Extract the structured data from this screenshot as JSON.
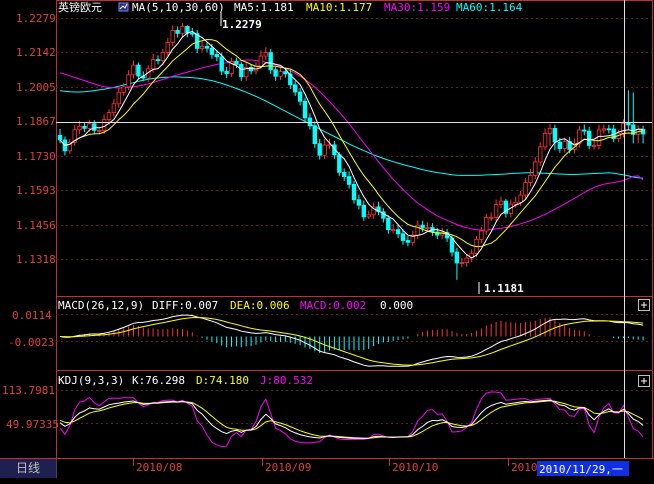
{
  "instrument": "英镑欧元",
  "period_tab": "日线",
  "colors": {
    "up": "#ff3232",
    "down": "#00ffff",
    "ma5": "#ffffff",
    "ma10": "#ffff00",
    "ma30": "#ff00ff",
    "ma60": "#00ffff",
    "axis": "#e04040"
  },
  "main_header": {
    "ma_label": "MA(5,10,30,60)",
    "ma5": "MA5:1.181",
    "ma10": "MA10:1.177",
    "ma30": "MA30:1.159",
    "ma60": "MA60:1.164"
  },
  "price_axis": [
    "1.2279",
    "1.2142",
    "1.2005",
    "1.1867",
    "1.1730",
    "1.1593",
    "1.1456",
    "1.1318"
  ],
  "annotations": {
    "high": "1.2279",
    "low": "1.1181"
  },
  "macd_header": {
    "label": "MACD(26,12,9)",
    "diff": "DIFF:0.007",
    "dea": "DEA:0.006",
    "macd": "MACD:0.002",
    "zero": "0.000"
  },
  "macd_axis": [
    "0.0114",
    "-0.0023"
  ],
  "kdj_header": {
    "label": "KDJ(9,3,3)",
    "k": "K:76.298",
    "d": "D:74.180",
    "j": "J:80.532"
  },
  "kdj_axis": [
    "113.7981",
    "49.97335"
  ],
  "date_axis": [
    "2010/08",
    "2010/09",
    "2010/10",
    "2010"
  ],
  "cursor_date": "2010/11/29,一",
  "chart_data": {
    "type": "candlestick",
    "title": "英镑欧元",
    "ylim": [
      1.112,
      1.232
    ],
    "open": [
      1.1805,
      1.1785,
      1.1738,
      1.1775,
      1.1829,
      1.1844,
      1.1835,
      1.1855,
      1.1826,
      1.1826,
      1.1873,
      1.1903,
      1.1941,
      1.1991,
      1.2014,
      1.2066,
      1.2108,
      1.2061,
      1.2052,
      1.2092,
      1.2132,
      1.2127,
      1.2163,
      1.2206,
      1.2258,
      1.2245,
      1.2275,
      1.2246,
      1.2244,
      1.218,
      1.2189,
      1.2181,
      1.2154,
      1.2144,
      1.2082,
      1.2071,
      1.2124,
      1.2111,
      1.2058,
      1.2098,
      1.2083,
      1.2103,
      1.2147,
      1.2162,
      1.2088,
      1.206,
      1.208,
      1.207,
      1.2023,
      1.1992,
      1.1952,
      1.188,
      1.1846,
      1.1769,
      1.1719,
      1.1763,
      1.1764,
      1.1721,
      1.1645,
      1.1627,
      1.1593,
      1.1527,
      1.1503,
      1.1453,
      1.1462,
      1.1496,
      1.1475,
      1.1447,
      1.1398,
      1.1398,
      1.138,
      1.1351,
      1.1343,
      1.1374,
      1.1417,
      1.1405,
      1.1407,
      1.1388,
      1.1374,
      1.1385,
      1.1362,
      1.1301,
      1.1254,
      1.1256,
      1.1275,
      1.1296,
      1.1356,
      1.1392,
      1.145,
      1.1451,
      1.1506,
      1.1521,
      1.1468,
      1.1508,
      1.1516,
      1.1547,
      1.1601,
      1.1632,
      1.169,
      1.1755,
      1.1813,
      1.1835,
      1.1776,
      1.1748,
      1.1778,
      1.1744,
      1.177,
      1.1828,
      1.1823,
      1.1761,
      1.1761,
      1.1828,
      1.1833,
      1.1832,
      1.1791,
      1.1813,
      1.1857,
      1.185,
      1.1809,
      1.183
    ],
    "close": [
      1.1785,
      1.1738,
      1.1775,
      1.1829,
      1.1844,
      1.1835,
      1.1855,
      1.1826,
      1.1826,
      1.1873,
      1.1903,
      1.1941,
      1.1991,
      1.2014,
      1.2066,
      1.2108,
      1.2061,
      1.2052,
      1.2092,
      1.2132,
      1.2127,
      1.2163,
      1.2206,
      1.2258,
      1.2245,
      1.2275,
      1.2246,
      1.2244,
      1.218,
      1.2189,
      1.2181,
      1.2154,
      1.2144,
      1.2082,
      1.2071,
      1.2124,
      1.2111,
      1.2058,
      1.2098,
      1.2083,
      1.2103,
      1.2147,
      1.2162,
      1.2088,
      1.206,
      1.208,
      1.207,
      1.2023,
      1.1992,
      1.1952,
      1.188,
      1.1846,
      1.1769,
      1.1719,
      1.1763,
      1.1764,
      1.1721,
      1.1645,
      1.1627,
      1.1593,
      1.1527,
      1.1503,
      1.1453,
      1.1462,
      1.1496,
      1.1475,
      1.1447,
      1.1398,
      1.1398,
      1.138,
      1.1351,
      1.1343,
      1.1374,
      1.1417,
      1.1405,
      1.1407,
      1.1388,
      1.1374,
      1.1385,
      1.1362,
      1.1301,
      1.1254,
      1.1256,
      1.1275,
      1.1296,
      1.1356,
      1.1392,
      1.145,
      1.1451,
      1.1506,
      1.1521,
      1.1468,
      1.1508,
      1.1516,
      1.1547,
      1.1601,
      1.1632,
      1.169,
      1.1755,
      1.1813,
      1.1835,
      1.1776,
      1.1748,
      1.1778,
      1.1744,
      1.177,
      1.1828,
      1.1823,
      1.1761,
      1.1761,
      1.1828,
      1.1833,
      1.1832,
      1.1791,
      1.1813,
      1.1857,
      1.185,
      1.1809,
      1.183,
      1.1811
    ],
    "high": [
      1.1832,
      1.18,
      1.179,
      1.185,
      1.1868,
      1.1862,
      1.1872,
      1.187,
      1.1841,
      1.1895,
      1.1917,
      1.1962,
      1.2012,
      1.203,
      1.2086,
      1.2128,
      1.212,
      1.2081,
      1.2109,
      1.2157,
      1.215,
      1.2178,
      1.2225,
      1.2279,
      1.2275,
      1.229,
      1.228,
      1.2268,
      1.226,
      1.2213,
      1.2207,
      1.22,
      1.217,
      1.216,
      1.21,
      1.214,
      1.214,
      1.2122,
      1.2121,
      1.2112,
      1.212,
      1.2172,
      1.2185,
      1.2178,
      1.21,
      1.2095,
      1.2097,
      1.2088,
      1.204,
      1.201,
      1.1968,
      1.19,
      1.1865,
      1.179,
      1.1789,
      1.179,
      1.1781,
      1.1732,
      1.1662,
      1.1649,
      1.1609,
      1.1549,
      1.1523,
      1.148,
      1.1515,
      1.1518,
      1.149,
      1.146,
      1.1422,
      1.142,
      1.14,
      1.137,
      1.1392,
      1.1437,
      1.1436,
      1.1429,
      1.1426,
      1.1405,
      1.1406,
      1.1401,
      1.1375,
      1.132,
      1.1275,
      1.1292,
      1.1312,
      1.137,
      1.141,
      1.1466,
      1.1472,
      1.1528,
      1.154,
      1.153,
      1.1528,
      1.154,
      1.1565,
      1.162,
      1.166,
      1.171,
      1.1775,
      1.1835,
      1.1854,
      1.185,
      1.1795,
      1.1795,
      1.1798,
      1.179,
      1.1846,
      1.1851,
      1.1842,
      1.1782,
      1.185,
      1.1852,
      1.185,
      1.185,
      1.183,
      1.1874,
      1.1999,
      1.199,
      1.1848,
      1.1846
    ],
    "low": [
      1.177,
      1.1718,
      1.1724,
      1.176,
      1.1811,
      1.1818,
      1.182,
      1.181,
      1.1808,
      1.1811,
      1.1852,
      1.1886,
      1.1923,
      1.1976,
      1.2,
      1.205,
      1.2045,
      1.204,
      1.2035,
      1.2075,
      1.2111,
      1.2108,
      1.2148,
      1.219,
      1.2227,
      1.2228,
      1.2228,
      1.2229,
      1.216,
      1.2166,
      1.2165,
      1.2135,
      1.2125,
      1.2065,
      1.2052,
      1.2057,
      1.2095,
      1.204,
      1.204,
      1.2068,
      1.2068,
      1.209,
      1.213,
      1.207,
      1.204,
      1.2043,
      1.2054,
      1.2005,
      1.1975,
      1.1934,
      1.1862,
      1.183,
      1.1751,
      1.17,
      1.1703,
      1.1747,
      1.1703,
      1.1629,
      1.1608,
      1.1575,
      1.151,
      1.1485,
      1.1436,
      1.1444,
      1.1445,
      1.146,
      1.1429,
      1.138,
      1.1381,
      1.1361,
      1.1332,
      1.1325,
      1.1328,
      1.1357,
      1.1388,
      1.1388,
      1.137,
      1.1357,
      1.1357,
      1.1345,
      1.1282,
      1.1181,
      1.1236,
      1.1238,
      1.1258,
      1.128,
      1.134,
      1.1375,
      1.1434,
      1.1435,
      1.149,
      1.145,
      1.145,
      1.1492,
      1.15,
      1.153,
      1.1584,
      1.1616,
      1.1673,
      1.174,
      1.176,
      1.174,
      1.173,
      1.173,
      1.1727,
      1.1727,
      1.1752,
      1.1805,
      1.1745,
      1.1744,
      1.1745,
      1.1812,
      1.1813,
      1.1775,
      1.1775,
      1.1796,
      1.183,
      1.177,
      1.177,
      1.177
    ],
    "ma30": [
      1.2075,
      1.2069,
      1.2062,
      1.2055,
      1.2048,
      1.2041,
      1.2034,
      1.2027,
      1.202,
      1.2015,
      1.2012,
      1.201,
      1.2009,
      1.201,
      1.2012,
      1.2015,
      1.2018,
      1.2022,
      1.2027,
      1.2033,
      1.204,
      1.2046,
      1.2053,
      1.206,
      1.2066,
      1.2072,
      1.2078,
      1.2084,
      1.209,
      1.2096,
      1.2101,
      1.2106,
      1.2111,
      1.2115,
      1.2118,
      1.2121,
      1.2124,
      1.2127,
      1.213,
      1.213,
      1.2128,
      1.2125,
      1.212,
      1.2115,
      1.211,
      1.2103,
      1.2094,
      1.2084,
      1.2073,
      1.206,
      1.2046,
      1.203,
      1.2013,
      1.1994,
      1.1973,
      1.1951,
      1.1928,
      1.1905,
      1.188,
      1.1855,
      1.1828,
      1.18,
      1.1772,
      1.1745,
      1.1718,
      1.1691,
      1.1665,
      1.164,
      1.1615,
      1.1593,
      1.1571,
      1.1551,
      1.1531,
      1.1513,
      1.1498,
      1.1484,
      1.147,
      1.1457,
      1.1447,
      1.1438,
      1.1429,
      1.142,
      1.1412,
      1.1406,
      1.1401,
      1.1398,
      1.1396,
      1.1396,
      1.1398,
      1.1401,
      1.1404,
      1.1407,
      1.1411,
      1.1417,
      1.1423,
      1.143,
      1.1437,
      1.1445,
      1.1454,
      1.1464,
      1.1475,
      1.1486,
      1.1497,
      1.1509,
      1.1521,
      1.1533,
      1.1545,
      1.1558,
      1.157,
      1.158,
      1.1588,
      1.1594,
      1.1598,
      1.1601,
      1.1605,
      1.161,
      1.1619,
      1.1628,
      1.163,
      1.1612
    ],
    "ma60": [
      1.1997,
      1.1995,
      1.1993,
      1.1992,
      1.1992,
      1.1993,
      1.1995,
      1.1998,
      1.2001,
      1.2004,
      1.2008,
      1.2012,
      1.2017,
      1.2022,
      1.2027,
      1.2032,
      1.2038,
      1.2043,
      1.2047,
      1.205,
      1.2053,
      1.2055,
      1.2056,
      1.2057,
      1.2057,
      1.2056,
      1.2055,
      1.2054,
      1.2052,
      1.2049,
      1.2045,
      1.2041,
      1.2035,
      1.2029,
      1.2022,
      1.2015,
      1.2007,
      1.1999,
      1.1991,
      1.1982,
      1.1973,
      1.1963,
      1.1953,
      1.1942,
      1.1931,
      1.192,
      1.1909,
      1.1898,
      1.1887,
      1.1876,
      1.1865,
      1.1854,
      1.1843,
      1.1832,
      1.1821,
      1.181,
      1.18,
      1.1789,
      1.1779,
      1.1768,
      1.1758,
      1.1748,
      1.1739,
      1.173,
      1.1721,
      1.1713,
      1.1705,
      1.1698,
      1.1691,
      1.1685,
      1.1679,
      1.1673,
      1.1668,
      1.1662,
      1.1657,
      1.1652,
      1.1648,
      1.1644,
      1.1641,
      1.1638,
      1.1635,
      1.1633,
      1.1632,
      1.1632,
      1.1632,
      1.1632,
      1.1633,
      1.1634,
      1.1635,
      1.1636,
      1.1637,
      1.1638,
      1.164,
      1.1641,
      1.1642,
      1.1643,
      1.1643,
      1.1643,
      1.1642,
      1.1641,
      1.164,
      1.1639,
      1.1638,
      1.1637,
      1.1636,
      1.1636,
      1.1637,
      1.1638,
      1.1639,
      1.164,
      1.1641,
      1.1642,
      1.1643,
      1.1641,
      1.1638,
      1.1635,
      1.163,
      1.1625,
      1.1622,
      1.162
    ]
  }
}
